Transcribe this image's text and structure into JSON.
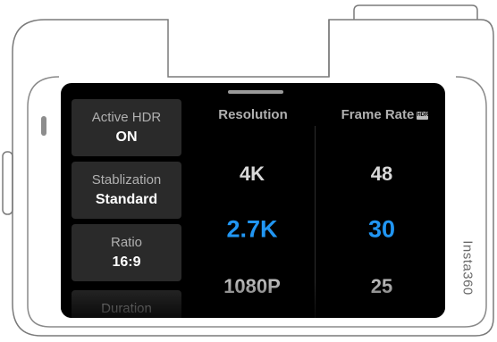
{
  "device": {
    "brand": "Insta360"
  },
  "settings": [
    {
      "label": "Active HDR",
      "value": "ON"
    },
    {
      "label": "Stablization",
      "value": "Standard"
    },
    {
      "label": "Ratio",
      "value": "16:9"
    },
    {
      "label": "Duration",
      "value": ""
    }
  ],
  "resolution": {
    "header": "Resolution",
    "options": [
      "4K",
      "2.7K",
      "1080P"
    ],
    "selected": "2.7K"
  },
  "frame_rate": {
    "header": "Frame Rate",
    "badge": "HDR",
    "options": [
      "48",
      "30",
      "25"
    ],
    "selected": "30"
  },
  "colors": {
    "accent": "#2196f3",
    "screen_bg": "#000000",
    "tile_bg": "#2a2a2a",
    "outline": "#7a7a7a"
  }
}
